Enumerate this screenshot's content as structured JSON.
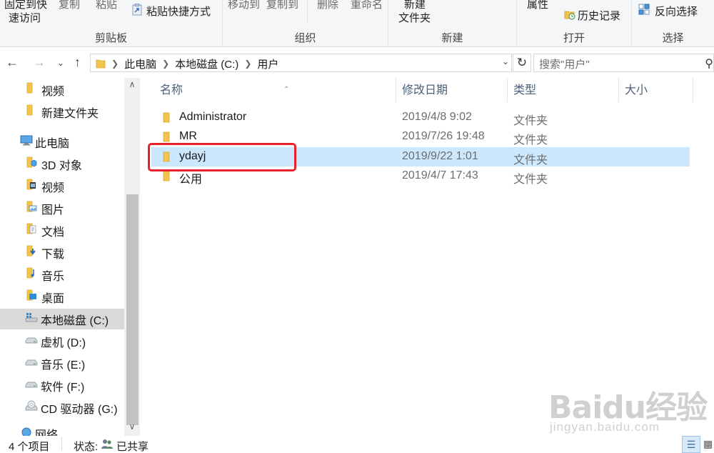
{
  "ribbon": {
    "groups": {
      "clipboard_label": "剪贴板",
      "organize_label": "组织",
      "new_label": "新建",
      "open_label": "打开",
      "select_label": "选择"
    },
    "pin_quick_access_line1": "固定到快",
    "pin_quick_access_line2": "速访问",
    "copy_label": "复制",
    "paste_label": "粘贴",
    "paste_shortcut_label": "粘贴快捷方式",
    "move_to_label": "移动到",
    "copy_to_label": "复制到",
    "delete_label": "删除",
    "rename_label": "重命名",
    "new_folder_line1": "新建",
    "new_folder_line2": "文件夹",
    "properties_label": "属性",
    "history_label": "历史记录",
    "invert_selection_label": "反向选择"
  },
  "address": {
    "crumbs": [
      "此电脑",
      "本地磁盘 (C:)",
      "用户"
    ],
    "search_placeholder": "搜索\"用户\""
  },
  "nav": {
    "items": [
      {
        "label": "视频",
        "icon": "folder-icon"
      },
      {
        "label": "新建文件夹",
        "icon": "folder-icon"
      },
      {
        "label": "此电脑",
        "icon": "computer-icon"
      },
      {
        "label": "3D 对象",
        "icon": "3d-objects-icon"
      },
      {
        "label": "视频",
        "icon": "videos-icon"
      },
      {
        "label": "图片",
        "icon": "pictures-icon"
      },
      {
        "label": "文档",
        "icon": "documents-icon"
      },
      {
        "label": "下载",
        "icon": "downloads-icon"
      },
      {
        "label": "音乐",
        "icon": "music-icon"
      },
      {
        "label": "桌面",
        "icon": "desktop-icon"
      },
      {
        "label": "本地磁盘 (C:)",
        "icon": "windows-drive-icon",
        "selected": true
      },
      {
        "label": "虚机 (D:)",
        "icon": "drive-icon"
      },
      {
        "label": "音乐 (E:)",
        "icon": "drive-icon"
      },
      {
        "label": "软件 (F:)",
        "icon": "drive-icon"
      },
      {
        "label": "CD 驱动器 (G:)",
        "icon": "cd-drive-icon"
      },
      {
        "label": "网络",
        "icon": "network-icon"
      }
    ]
  },
  "files": {
    "columns": {
      "name": "名称",
      "date": "修改日期",
      "type": "类型",
      "size": "大小"
    },
    "rows": [
      {
        "name": "Administrator",
        "date": "2019/4/8 9:02",
        "type": "文件夹"
      },
      {
        "name": "MR",
        "date": "2019/7/26 19:48",
        "type": "文件夹"
      },
      {
        "name": "ydayj",
        "date": "2019/9/22 1:01",
        "type": "文件夹",
        "selected": true
      },
      {
        "name": "公用",
        "date": "2019/4/7 17:43",
        "type": "文件夹"
      }
    ]
  },
  "status": {
    "item_count": "4 个项目",
    "state_label": "状态:",
    "shared_label": "已共享"
  },
  "watermark": {
    "logo": "Baidu经验",
    "url": "jingyan.baidu.com"
  },
  "colors": {
    "selection": "#cce8ff",
    "nav_selected": "#d9d9d9",
    "highlight_annotation": "#e8222a",
    "folder_yellow": "#f2c44e"
  }
}
